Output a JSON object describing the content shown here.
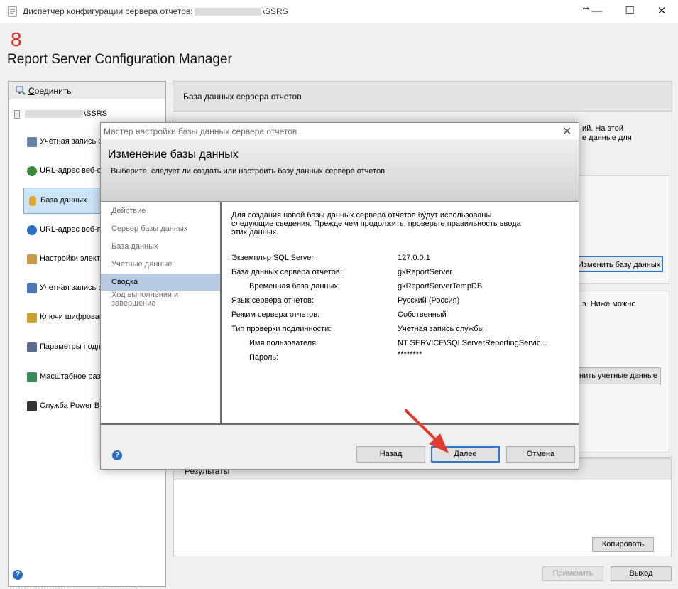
{
  "window": {
    "title_prefix": "Диспетчер конфигурации сервера отчетов:",
    "title_suffix": "\\SSRS",
    "controls": {
      "minimize": "—",
      "maximize": "☐",
      "close": "✕",
      "resize": "↔"
    }
  },
  "header": {
    "step_number": "8",
    "app_title": "Report Server Configuration Manager"
  },
  "sidebar": {
    "connect_label_underlined": "С",
    "connect_label_rest": "оединить",
    "server_suffix": "\\SSRS",
    "items": [
      {
        "label": "Учетная запись с",
        "icon": "service-account-icon",
        "color": "#6a7fa8"
      },
      {
        "label": "URL-адрес веб-с",
        "icon": "web-service-url-icon",
        "color": "#3b8a3b"
      },
      {
        "label": "База данных",
        "icon": "database-icon",
        "color": "#e2a62a"
      },
      {
        "label": "URL-адрес веб-п",
        "icon": "web-portal-url-icon",
        "color": "#2b6cc4"
      },
      {
        "label": "Настройки элект",
        "icon": "email-settings-icon",
        "color": "#c89a4a"
      },
      {
        "label": "Учетная запись в",
        "icon": "execution-account-icon",
        "color": "#4a78b8"
      },
      {
        "label": "Ключи шифрован",
        "icon": "encryption-keys-icon",
        "color": "#c8a02a"
      },
      {
        "label": "Параметры подп",
        "icon": "subscription-settings-icon",
        "color": "#5a6a8a"
      },
      {
        "label": "Масштабное раз",
        "icon": "scale-out-icon",
        "color": "#3a8a5a"
      },
      {
        "label": "Служба Power BI",
        "icon": "power-bi-icon",
        "color": "#333333"
      }
    ]
  },
  "background": {
    "right_header": "База данных сервера отчетов",
    "desc_line1": "ий. На этой",
    "desc_line2": "е данные для",
    "change_db_button": "Изменить базу данных",
    "desc_line3": "э. Ниже можно",
    "change_cred_button": "нить учетные данные",
    "results_label": "Результаты",
    "copy_button": "Копировать",
    "apply_button": "Применить",
    "exit_button": "Выход"
  },
  "dialog": {
    "title": "Мастер настройки базы данных сервера отчетов",
    "close": "✕",
    "heading": "Изменение базы данных",
    "subheading": "Выберите, следует ли создать или настроить базу данных сервера отчетов.",
    "steps": [
      "Действие",
      "Сервер базы данных",
      "База данных",
      "Учетные данные",
      "Сводка"
    ],
    "step_last_line1": "Ход выполнения и",
    "step_last_line2": "завершение",
    "intro_line1": "Для создания новой базы данных сервера отчетов будут использованы",
    "intro_line2": "следующие сведения. Прежде чем продолжить, проверьте правильность ввода",
    "intro_line3": "этих данных.",
    "summary": [
      {
        "label": "Экземпляр SQL Server:",
        "value": "127.0.0.1"
      },
      {
        "label": "База данных сервера отчетов:",
        "value": "gkReportServer"
      },
      {
        "label": "Временная база данных:",
        "value": "gkReportServerTempDB"
      },
      {
        "label": "Язык сервера отчетов:",
        "value": "Русский (Россия)"
      },
      {
        "label": "Режим сервера отчетов:",
        "value": "Собственный"
      },
      {
        "label": "Тип проверки подлинности:",
        "value": "Учетная запись службы"
      },
      {
        "label": "Имя пользователя:",
        "value": "NT SERVICE\\SQLServerReportingServic..."
      },
      {
        "label": "Пароль:",
        "value": "********"
      }
    ],
    "buttons": {
      "back": "Назад",
      "next": "Далее",
      "cancel": "Отмена"
    }
  },
  "help_glyph": "?",
  "colors": {
    "accent_blue": "#2b79d1",
    "arrow_red": "#e23b2e",
    "selected_step": "#b8cbe3",
    "header_number": "#e12a2a"
  }
}
